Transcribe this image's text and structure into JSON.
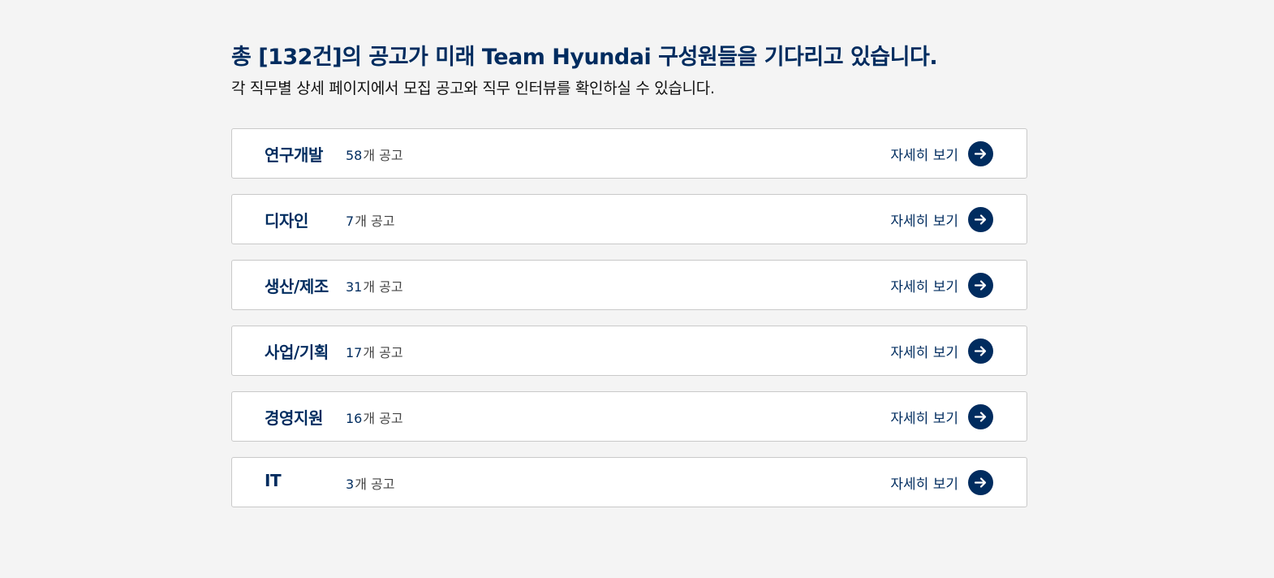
{
  "header": {
    "title": "총 [132건]의 공고가 미래 Team Hyundai 구성원들을 기다리고 있습니다.",
    "subtitle": "각 직무별 상세 페이지에서 모집 공고와 직무 인터뷰를 확인하실 수 있습니다."
  },
  "categories": [
    {
      "name": "연구개발",
      "count": "58",
      "unit": "개 공고",
      "action": "자세히 보기",
      "icon": "arrow-right-icon"
    },
    {
      "name": "디자인",
      "count": "7",
      "unit": "개 공고",
      "action": "자세히 보기",
      "icon": "arrow-right-icon"
    },
    {
      "name": "생산/제조",
      "count": "31",
      "unit": "개 공고",
      "action": "자세히 보기",
      "icon": "arrow-right-icon"
    },
    {
      "name": "사업/기획",
      "count": "17",
      "unit": "개 공고",
      "action": "자세히 보기",
      "icon": "arrow-right-icon"
    },
    {
      "name": "경영지원",
      "count": "16",
      "unit": "개 공고",
      "action": "자세히 보기",
      "icon": "arrow-right-icon"
    },
    {
      "name": "IT",
      "count": "3",
      "unit": "개 공고",
      "action": "자세히 보기",
      "icon": "arrow-right-icon"
    }
  ],
  "colors": {
    "brand": "#002c5f",
    "background": "#f4f4f4",
    "card": "#ffffff",
    "border": "#c9c9c9"
  }
}
